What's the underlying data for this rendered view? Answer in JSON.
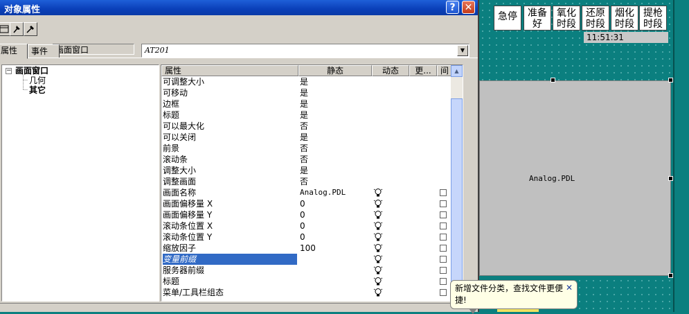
{
  "dialog": {
    "title": "对象属性",
    "help_label": "?",
    "close_label": "✕",
    "object_type": "画面窗口",
    "object_name": "AT201",
    "tabs": [
      "属性",
      "事件"
    ]
  },
  "tree": {
    "root": "画面窗口",
    "collapse_glyph": "−",
    "children": [
      "几何",
      "其它"
    ]
  },
  "grid": {
    "headers": [
      "属性",
      "静态",
      "动态",
      "更...",
      "间"
    ],
    "rows": [
      {
        "name": "可调整大小",
        "static": "是"
      },
      {
        "name": "可移动",
        "static": "是"
      },
      {
        "name": "边框",
        "static": "是"
      },
      {
        "name": "标题",
        "static": "是"
      },
      {
        "name": "可以最大化",
        "static": "否"
      },
      {
        "name": "可以关闭",
        "static": "是"
      },
      {
        "name": "前景",
        "static": "否"
      },
      {
        "name": "滚动条",
        "static": "否"
      },
      {
        "name": "调整大小",
        "static": "是"
      },
      {
        "name": "调整画面",
        "static": "否"
      },
      {
        "name": "画面名称",
        "static": "Analog.PDL"
      },
      {
        "name": "画面偏移量 X",
        "static": "0"
      },
      {
        "name": "画面偏移量 Y",
        "static": "0"
      },
      {
        "name": "滚动条位置 X",
        "static": "0"
      },
      {
        "name": "滚动条位置 Y",
        "static": "0"
      },
      {
        "name": "缩放因子",
        "static": "100"
      },
      {
        "name": "变量前缀",
        "static": ""
      },
      {
        "name": "服务器前缀",
        "static": ""
      },
      {
        "name": "标题",
        "static": ""
      },
      {
        "name": "菜单/工具栏组态",
        "static": ""
      }
    ]
  },
  "canvas": {
    "buttons": [
      "急停",
      "准备好",
      "氧化时段",
      "还原时段",
      "烟化时段",
      "提枪时段"
    ],
    "time": "11:51:31",
    "window_label": "Analog.PDL"
  },
  "tooltip": {
    "text": "新增文件分类，查找文件更便捷!",
    "close": "✕"
  }
}
